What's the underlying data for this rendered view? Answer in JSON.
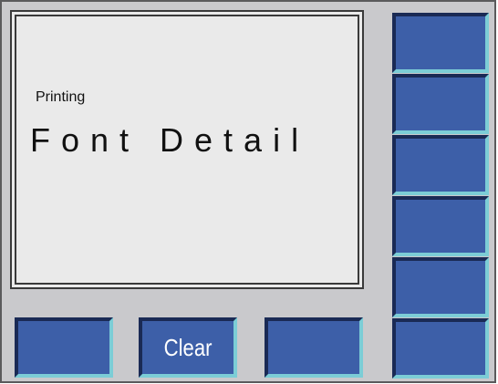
{
  "display": {
    "line1": "Printing",
    "line2": "Font Detail"
  },
  "bottom_keys": [
    {
      "label": ""
    },
    {
      "label": "Clear"
    },
    {
      "label": ""
    }
  ],
  "side_keys": [
    {
      "label": ""
    },
    {
      "label": ""
    },
    {
      "label": ""
    },
    {
      "label": ""
    },
    {
      "label": ""
    },
    {
      "label": ""
    }
  ],
  "colors": {
    "panel": "#c9c9cc",
    "screen": "#eaeaea",
    "key": "#3d5fa8",
    "key_highlight": "#7ccdd6",
    "key_shadow": "#1a2a55"
  }
}
